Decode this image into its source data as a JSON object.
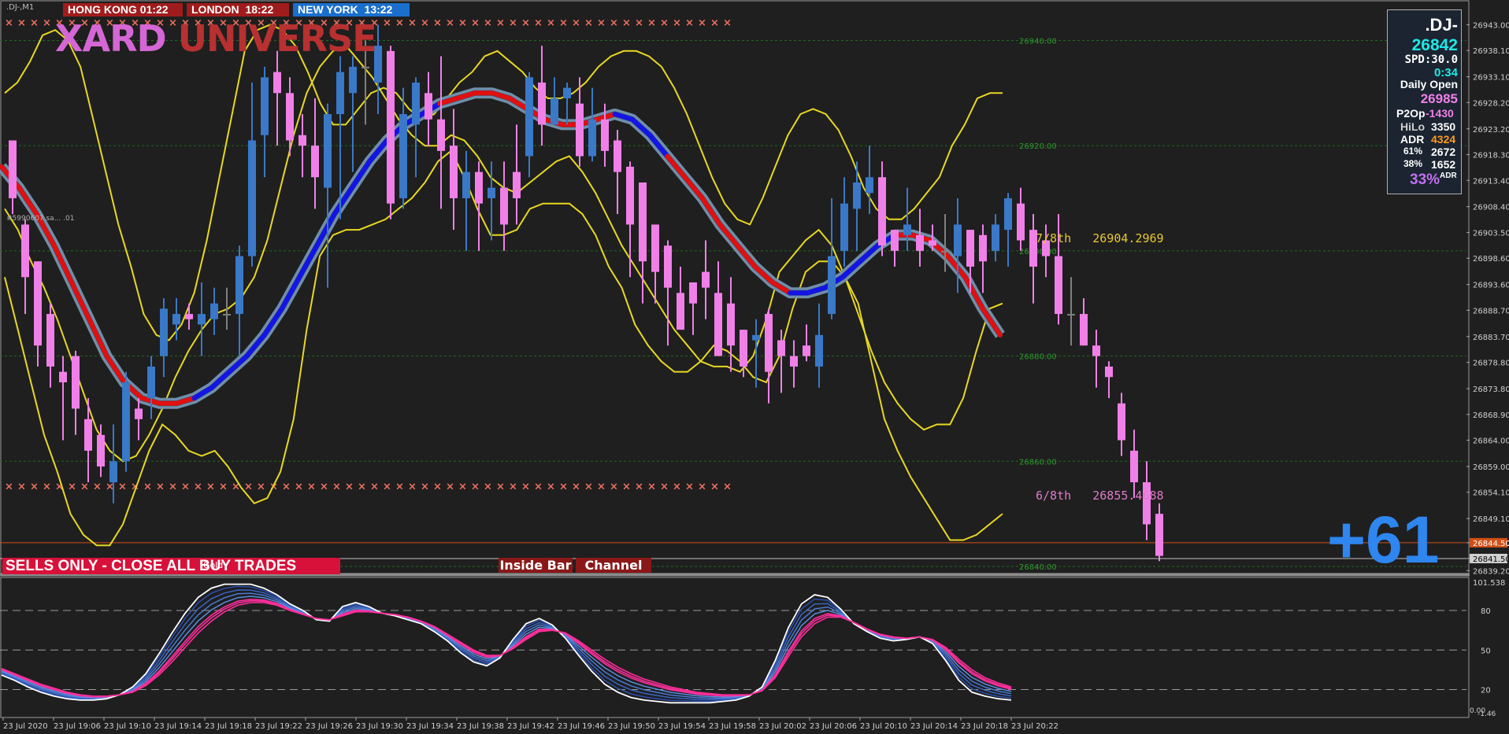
{
  "symbol_label": ".DJ-,M1",
  "sessions": [
    {
      "label": "HONG KONG 01:22",
      "color": "#a01c1c"
    },
    {
      "label": "LONDON  18:22",
      "color": "#a01c1c"
    },
    {
      "label": "NEW YORK  13:22",
      "color": "#1a6fcc"
    }
  ],
  "logo": {
    "word1": "XARD",
    "word2": "UNIVERSE"
  },
  "id_label": "#5990607 sa... .01",
  "info_panel": {
    "symbol": ".DJ-",
    "price": "26842",
    "spd": "SPD:30.0",
    "timer": "0:34",
    "daily_open_label": "Daily Open",
    "daily_open": "26985",
    "p2op_label": "P2Op",
    "p2op": "-1430",
    "hilo_label": "HiLo",
    "hilo": "3350",
    "adr_label": "ADR",
    "adr": "4324",
    "pct61_label": "61%",
    "pct61": "2672",
    "pct38_label": "38%",
    "pct38": "1652",
    "adr_pct": "33%",
    "adr_pct_suffix": "ADR"
  },
  "banner": "SELLS ONLY - CLOSE ALL BUY TRADES",
  "gold_label": "Gold",
  "tags": {
    "inside_bar": "Inside Bar",
    "channel": "Channel"
  },
  "pips": "+61",
  "fib_7": "7/8th   26904.2969",
  "fib_6": "6/8th   26855.4688",
  "colors": {
    "bull": "#3a78c8",
    "bear": "#f080e8",
    "doji": "#808080",
    "band": "#e8d820",
    "ma_up": "#1414e6",
    "ma_down": "#e01010",
    "ma_edge": "#6f8faa",
    "osc_main": "#ffffff",
    "osc_fast": "#ff2f9c",
    "osc_slow": "#3a6fd8"
  },
  "chart_data": [
    {
      "type": "candlestick",
      "title": "",
      "price_axis": {
        "ticks": [
          "26943.00",
          "26938.10",
          "26933.10",
          "26928.20",
          "26923.20",
          "26918.30",
          "26913.40",
          "26908.40",
          "26903.50",
          "26898.60",
          "26893.60",
          "26888.70",
          "26883.70",
          "26878.80",
          "26873.80",
          "26868.90",
          "26864.00",
          "26859.00",
          "26854.10",
          "26849.10",
          "26844.50",
          "26841.50",
          "26839.20"
        ],
        "ylim": [
          26838.5,
          26946.5
        ],
        "last_price_tags": [
          "26844.50",
          "26841.50"
        ]
      },
      "time_axis": {
        "ticks": [
          "23 Jul 2020",
          "23 Jul 19:06",
          "23 Jul 19:10",
          "23 Jul 19:14",
          "23 Jul 19:18",
          "23 Jul 19:22",
          "23 Jul 19:26",
          "23 Jul 19:30",
          "23 Jul 19:34",
          "23 Jul 19:38",
          "23 Jul 19:42",
          "23 Jul 19:46",
          "23 Jul 19:50",
          "23 Jul 19:54",
          "23 Jul 19:58",
          "23 Jul 20:02",
          "23 Jul 20:06",
          "23 Jul 20:10",
          "23 Jul 20:14",
          "23 Jul 20:18",
          "23 Jul 20:22"
        ]
      },
      "level_lines": [
        {
          "price": 26940.0,
          "label": "26940.00"
        },
        {
          "price": 26920.0,
          "label": "26920.00"
        },
        {
          "price": 26900.0,
          "label": "26900.00"
        },
        {
          "price": 26880.0,
          "label": "26880.00"
        },
        {
          "price": 26860.0,
          "label": "26860.00"
        },
        {
          "price": 26840.0,
          "label": "26840.00"
        }
      ],
      "x_marker_levels": [
        26943.5,
        26855.3
      ],
      "candles": [
        [
          26921,
          26910,
          26920,
          26907
        ],
        [
          26905,
          26895,
          26906,
          26888
        ],
        [
          26898,
          26882,
          26898,
          26878
        ],
        [
          26888,
          26878,
          26890,
          26874
        ],
        [
          26877,
          26875,
          26880,
          26864
        ],
        [
          26880,
          26870,
          26881,
          26865
        ],
        [
          26868,
          26862,
          26872,
          26856
        ],
        [
          26865,
          26859,
          26867,
          26857
        ],
        [
          26856,
          26860,
          26867,
          26852
        ],
        [
          26860,
          26875,
          26877,
          26858
        ],
        [
          26870,
          26868,
          26872,
          26864
        ],
        [
          26872,
          26878,
          26880,
          26868
        ],
        [
          26880,
          26889,
          26891,
          26876
        ],
        [
          26886,
          26888,
          26891,
          26883
        ],
        [
          26888,
          26887,
          26890,
          26885
        ],
        [
          26886,
          26888,
          26894,
          26880
        ],
        [
          26887,
          26890,
          26893,
          26884
        ],
        [
          26888,
          26888,
          26893,
          26885
        ],
        [
          26888,
          26899,
          26901,
          26880
        ],
        [
          26899,
          26921,
          26932,
          26897
        ],
        [
          26922,
          26933,
          26935,
          26914
        ],
        [
          26934,
          26930,
          26938,
          26920
        ],
        [
          26930,
          26921,
          26933,
          26918
        ],
        [
          26922,
          26920,
          26926,
          26914
        ],
        [
          26920,
          26914,
          26929,
          26908
        ],
        [
          26912,
          26926,
          26928,
          26893
        ],
        [
          26926,
          26934,
          26937,
          26906
        ],
        [
          26930,
          26935,
          26937,
          26915
        ],
        [
          26935,
          26935,
          26940,
          26924
        ],
        [
          26932,
          26939,
          26943,
          26926
        ],
        [
          26938,
          26909,
          26939,
          26906
        ],
        [
          26910,
          26926,
          26931,
          26908
        ],
        [
          26924,
          26932,
          26933,
          26914
        ],
        [
          26930,
          26925,
          26934,
          26920
        ],
        [
          26925,
          26919,
          26937,
          26908
        ],
        [
          26920,
          26910,
          26927,
          26904
        ],
        [
          26910,
          26915,
          26919,
          26900
        ],
        [
          26915,
          26909,
          26917,
          26900
        ],
        [
          26910,
          26912,
          26917,
          26902
        ],
        [
          26912,
          26905,
          26917,
          26900
        ],
        [
          26915,
          26910,
          26924,
          26905
        ],
        [
          26918,
          26933,
          26934,
          26914
        ],
        [
          26932,
          26924,
          26939,
          26920
        ],
        [
          26924,
          26929,
          26933,
          26925
        ],
        [
          26929,
          26931,
          26932,
          26924
        ],
        [
          26928,
          26918,
          26933,
          26916
        ],
        [
          26918,
          26925,
          26931,
          26917
        ],
        [
          26925,
          26919,
          26928,
          26916
        ],
        [
          26921,
          26915,
          26923,
          26907
        ],
        [
          26916,
          26905,
          26917,
          26895
        ],
        [
          26913,
          26898,
          26913,
          26890
        ],
        [
          26905,
          26896,
          26905,
          26890
        ],
        [
          26901,
          26893,
          26902,
          26882
        ],
        [
          26892,
          26885,
          26897,
          26886
        ],
        [
          26894,
          26890,
          26894,
          26884
        ],
        [
          26896,
          26893,
          26902,
          26887
        ],
        [
          26892,
          26880,
          26898,
          26880
        ],
        [
          26890,
          26882,
          26895,
          26877
        ],
        [
          26885,
          26878,
          26885,
          26876
        ],
        [
          26883,
          26884,
          26887,
          26874
        ],
        [
          26888,
          26877,
          26889,
          26871
        ],
        [
          26883,
          26880,
          26885,
          26873
        ],
        [
          26880,
          26878,
          26883,
          26874
        ],
        [
          26882,
          26880,
          26886,
          26879
        ],
        [
          26878,
          26884,
          26890,
          26874
        ],
        [
          26888,
          26899,
          26910,
          26887
        ],
        [
          26900,
          26909,
          26914,
          26897
        ],
        [
          26908,
          26913,
          26917,
          26900
        ],
        [
          26911,
          26914,
          26920,
          26907
        ],
        [
          26914,
          26901,
          26917,
          26899
        ],
        [
          26904,
          26900,
          26904,
          26897
        ],
        [
          26903,
          26905,
          26912,
          26900
        ],
        [
          26903,
          26900,
          26908,
          26897
        ],
        [
          26902,
          26901,
          26905,
          26900
        ],
        [
          26900,
          26900,
          26907,
          26896
        ],
        [
          26899,
          26905,
          26910,
          26892
        ],
        [
          26904,
          26897,
          26904,
          26892
        ],
        [
          26903,
          26898,
          26905,
          26892
        ],
        [
          26900,
          26905,
          26907,
          26898
        ],
        [
          26904,
          26910,
          26911,
          26897
        ],
        [
          26909,
          26902,
          26912,
          26900
        ],
        [
          26904,
          26897,
          26907,
          26890
        ],
        [
          26902,
          26899,
          26905,
          26895
        ],
        [
          26899,
          26888,
          26907,
          26886
        ],
        [
          26888,
          26888,
          26895,
          26882
        ],
        [
          26888,
          26882,
          26891,
          26882
        ],
        [
          26882,
          26880,
          26885,
          26874
        ],
        [
          26878,
          26876,
          26879,
          26872
        ],
        [
          26871,
          26864,
          26873,
          26861
        ],
        [
          26862,
          26856,
          26866,
          26853
        ],
        [
          26856,
          26848,
          26860,
          26845
        ],
        [
          26850,
          26842,
          26852,
          26841
        ]
      ],
      "band_upper": [
        26930,
        26932,
        26936,
        26941,
        26942,
        26940,
        26935,
        26925,
        26915,
        26905,
        26897,
        26888,
        26884,
        26883,
        26886,
        26892,
        26902,
        26914,
        26926,
        26938,
        26942,
        26943,
        26942,
        26939,
        26934,
        26928,
        26924,
        26924,
        26927,
        26930,
        26931,
        26930,
        26927,
        26925,
        26926,
        26929,
        26932,
        26934,
        26937,
        26938,
        26936,
        26934,
        26931,
        26929,
        26929,
        26930,
        26932,
        26935,
        26937,
        26938,
        26938,
        26937,
        26935,
        26931,
        26926,
        26920,
        26914,
        26909,
        26906,
        26905,
        26910,
        26916,
        26922,
        26926,
        26927,
        26926,
        26923,
        26918,
        26912,
        26908,
        26906,
        26906,
        26908,
        26911,
        26914,
        26920,
        26924,
        26929,
        26930,
        26930
      ],
      "band_mid": [
        26908,
        26904,
        26898,
        26893,
        26887,
        26880,
        26873,
        26866,
        26862,
        26860,
        26861,
        26865,
        26870,
        26876,
        26881,
        26885,
        26888,
        26889,
        26891,
        26895,
        26902,
        26912,
        26922,
        26930,
        26935,
        26938,
        26939,
        26936,
        26933,
        26929,
        26925,
        26922,
        26920,
        26920,
        26922,
        26921,
        26918,
        26914,
        26912,
        26911,
        26913,
        26915,
        26917,
        26918,
        26915,
        26911,
        26906,
        26901,
        26897,
        26893,
        26889,
        26885,
        26882,
        26879,
        26878,
        26878,
        26877,
        26880,
        26887,
        26896,
        26899,
        26902,
        26904,
        26901,
        26895,
        26888,
        26881,
        26875,
        26871,
        26868,
        26866,
        26867,
        26867,
        26872,
        26881,
        26889,
        26890
      ],
      "band_lower": [
        26895,
        26885,
        26875,
        26865,
        26858,
        26850,
        26846,
        26844,
        26844,
        26848,
        26855,
        26862,
        26867,
        26865,
        26862,
        26861,
        26862,
        26859,
        26855,
        26852,
        26853,
        26858,
        26868,
        26885,
        26899,
        26903,
        26904,
        26904,
        26905,
        26906,
        26908,
        26910,
        26913,
        26917,
        26919,
        26914,
        26908,
        26903,
        26903,
        26904,
        26908,
        26909,
        26909,
        26909,
        26907,
        26903,
        26897,
        26893,
        26886,
        26882,
        26879,
        26877,
        26877,
        26879,
        26882,
        26881,
        26879,
        26876,
        26875,
        26880,
        26889,
        26896,
        26898,
        26898,
        26895,
        26890,
        26879,
        26868,
        26862,
        26857,
        26853,
        26849,
        26845,
        26845,
        26846,
        26848,
        26850
      ],
      "ma_center": [
        26916,
        26912,
        26907,
        26901,
        26894,
        26887,
        26880,
        26875,
        26872,
        26871,
        26871,
        26872,
        26874,
        26877,
        26880,
        26884,
        26889,
        26895,
        26901,
        26907,
        26912,
        26917,
        26921,
        26924,
        26926,
        26928,
        26929,
        26930,
        26930,
        26929,
        26927,
        26925,
        26924,
        26924,
        26925,
        26926,
        26925,
        26922,
        26918,
        26914,
        26910,
        26905,
        26901,
        26897,
        26894,
        26892,
        26892,
        26893,
        26895,
        26898,
        26901,
        26903,
        26903,
        26902,
        26899,
        26895,
        26889,
        26884
      ],
      "ma_trend": [
        "d",
        "d",
        "d",
        "d",
        "d",
        "d",
        "d",
        "d",
        "d",
        "d",
        "d",
        "u",
        "u",
        "u",
        "u",
        "u",
        "u",
        "u",
        "u",
        "u",
        "u",
        "u",
        "u",
        "u",
        "u",
        "d",
        "d",
        "d",
        "d",
        "d",
        "d",
        "d",
        "d",
        "d",
        "d",
        "u",
        "u",
        "u",
        "d",
        "d",
        "d",
        "d",
        "d",
        "d",
        "d",
        "u",
        "u",
        "u",
        "u",
        "u",
        "u",
        "d",
        "d",
        "d",
        "d",
        "d",
        "d",
        "d"
      ]
    },
    {
      "type": "line",
      "title": "",
      "ylim": [
        0,
        101.538
      ],
      "levels": [
        80,
        50,
        20
      ],
      "axis_ticks": [
        "101.538",
        "80",
        "50",
        "20",
        "0.00",
        "-1.46"
      ],
      "series": [
        {
          "role": "main",
          "values": [
            31,
            27,
            22,
            18,
            15,
            13,
            12,
            12,
            13,
            16,
            22,
            32,
            47,
            63,
            78,
            90,
            97,
            100,
            101,
            100,
            97,
            92,
            85,
            80,
            73,
            72,
            83,
            86,
            83,
            78,
            76,
            73,
            70,
            64,
            57,
            48,
            41,
            38,
            44,
            58,
            70,
            74,
            69,
            59,
            46,
            34,
            24,
            18,
            14,
            12,
            11,
            10,
            10,
            10,
            10,
            11,
            12,
            15,
            22,
            42,
            67,
            85,
            92,
            90,
            81,
            70,
            64,
            59,
            57,
            58,
            60,
            55,
            42,
            27,
            18,
            15,
            13,
            12
          ]
        },
        {
          "role": "signal",
          "values": [
            36,
            32,
            28,
            24,
            21,
            18,
            16,
            15,
            15,
            16,
            18,
            23,
            31,
            41,
            52,
            63,
            72,
            79,
            84,
            86,
            86,
            84,
            80,
            77,
            74,
            73,
            76,
            79,
            79,
            78,
            77,
            75,
            72,
            68,
            62,
            56,
            50,
            46,
            46,
            51,
            58,
            64,
            65,
            63,
            57,
            50,
            43,
            37,
            32,
            28,
            25,
            22,
            20,
            18,
            17,
            16,
            16,
            16,
            19,
            29,
            45,
            60,
            70,
            75,
            75,
            71,
            66,
            62,
            60,
            59,
            60,
            58,
            52,
            43,
            35,
            29,
            25,
            22
          ]
        }
      ]
    }
  ]
}
